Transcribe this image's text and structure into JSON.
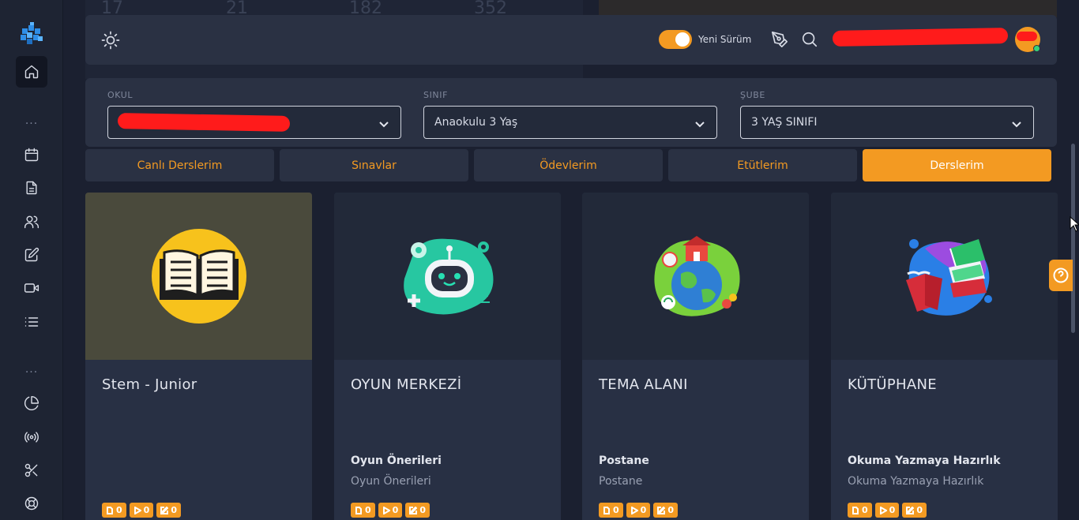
{
  "background_stats": [
    "17",
    "21",
    "182",
    "352"
  ],
  "sidebar": {
    "items": [
      {
        "icon": "home-icon",
        "active": true
      },
      {
        "icon": "calendar-icon"
      },
      {
        "icon": "document-icon"
      },
      {
        "icon": "users-icon"
      },
      {
        "icon": "edit-icon"
      },
      {
        "icon": "video-icon"
      },
      {
        "icon": "list-icon"
      },
      {
        "icon": "pie-chart-icon"
      },
      {
        "icon": "broadcast-icon"
      },
      {
        "icon": "scissors-icon"
      },
      {
        "icon": "lifebuoy-icon"
      }
    ],
    "dots": "..."
  },
  "topbar": {
    "toggle_on": true,
    "version_label": "Yeni Sürüm"
  },
  "filters": {
    "school_label": "OKUL",
    "class_label": "SINIF",
    "class_value": "Anaokulu 3 Yaş",
    "section_label": "ŞUBE",
    "section_value": "3 YAŞ SINIFI"
  },
  "tabs": [
    "Canlı Derslerim",
    "Sınavlar",
    "Ödevlerim",
    "Etütlerim",
    "Derslerim"
  ],
  "active_tab": "Derslerim",
  "cards": [
    {
      "title": "Stem - Junior",
      "sub1": "",
      "sub2": "",
      "counts": [
        "0",
        "0",
        "0"
      ]
    },
    {
      "title": "OYUN MERKEZİ",
      "sub1": "Oyun Önerileri",
      "sub2": "Oyun Önerileri",
      "counts": [
        "0",
        "0",
        "0"
      ]
    },
    {
      "title": "TEMA ALANI",
      "sub1": "Postane",
      "sub2": "Postane",
      "counts": [
        "0",
        "0",
        "0"
      ]
    },
    {
      "title": "KÜTÜPHANE",
      "sub1": "Okuma Yazmaya Hazırlık",
      "sub2": "Okuma Yazmaya Hazırlık",
      "counts": [
        "0",
        "0",
        "0"
      ]
    }
  ],
  "colors": {
    "accent": "#f39a22",
    "panel": "#2a3143",
    "background": "#1b2030"
  }
}
